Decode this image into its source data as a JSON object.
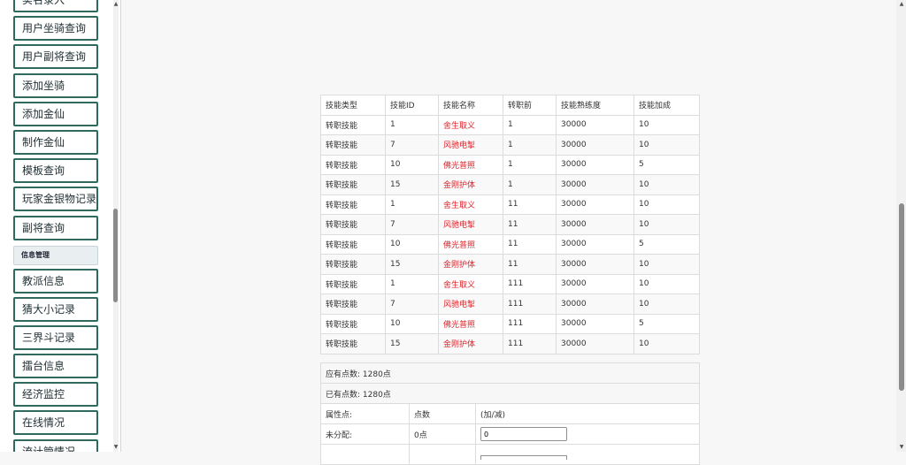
{
  "sidebar": {
    "items_top": [
      {
        "label": "实名录入"
      },
      {
        "label": "用户坐骑查询"
      },
      {
        "label": "用户副将查询"
      },
      {
        "label": "添加坐骑"
      },
      {
        "label": "添加金仙"
      },
      {
        "label": "制作金仙"
      },
      {
        "label": "模板查询"
      },
      {
        "label": "玩家金银物记录"
      },
      {
        "label": "副将查询"
      }
    ],
    "section_title": "信息管理",
    "items_bottom": [
      {
        "label": "教派信息"
      },
      {
        "label": "猜大小记录"
      },
      {
        "label": "三界斗记录"
      },
      {
        "label": "擂台信息"
      },
      {
        "label": "经济监控"
      },
      {
        "label": "在线情况"
      },
      {
        "label": "流计管情况"
      }
    ]
  },
  "skill_table": {
    "headers": [
      "技能类型",
      "技能ID",
      "技能名称",
      "转职前",
      "技能熟练度",
      "技能加成"
    ],
    "rows": [
      [
        "转职技能",
        "1",
        "舍生取义",
        "1",
        "30000",
        "10"
      ],
      [
        "转职技能",
        "7",
        "风驰电掣",
        "1",
        "30000",
        "10"
      ],
      [
        "转职技能",
        "10",
        "佛光普照",
        "1",
        "30000",
        "5"
      ],
      [
        "转职技能",
        "15",
        "金刚护体",
        "1",
        "30000",
        "10"
      ],
      [
        "转职技能",
        "1",
        "舍生取义",
        "11",
        "30000",
        "10"
      ],
      [
        "转职技能",
        "7",
        "风驰电掣",
        "11",
        "30000",
        "10"
      ],
      [
        "转职技能",
        "10",
        "佛光普照",
        "11",
        "30000",
        "5"
      ],
      [
        "转职技能",
        "15",
        "金刚护体",
        "11",
        "30000",
        "10"
      ],
      [
        "转职技能",
        "1",
        "舍生取义",
        "111",
        "30000",
        "10"
      ],
      [
        "转职技能",
        "7",
        "风驰电掣",
        "111",
        "30000",
        "10"
      ],
      [
        "转职技能",
        "10",
        "佛光普照",
        "111",
        "30000",
        "5"
      ],
      [
        "转职技能",
        "15",
        "金刚护体",
        "111",
        "30000",
        "10"
      ]
    ],
    "skill_name_color": "#e0222a"
  },
  "points": {
    "should_have": "应有点数: 1280点",
    "already_have": "已有点数: 1280点",
    "col_attr": "属性点:",
    "col_points": "点数",
    "col_adjust": "(加/减)",
    "unassigned_label": "未分配:",
    "unassigned_value": "0点",
    "unassigned_input": "0"
  },
  "colors": {
    "sidebar_border": "#2e6a5e",
    "page_bg": "#f7f7f7"
  }
}
